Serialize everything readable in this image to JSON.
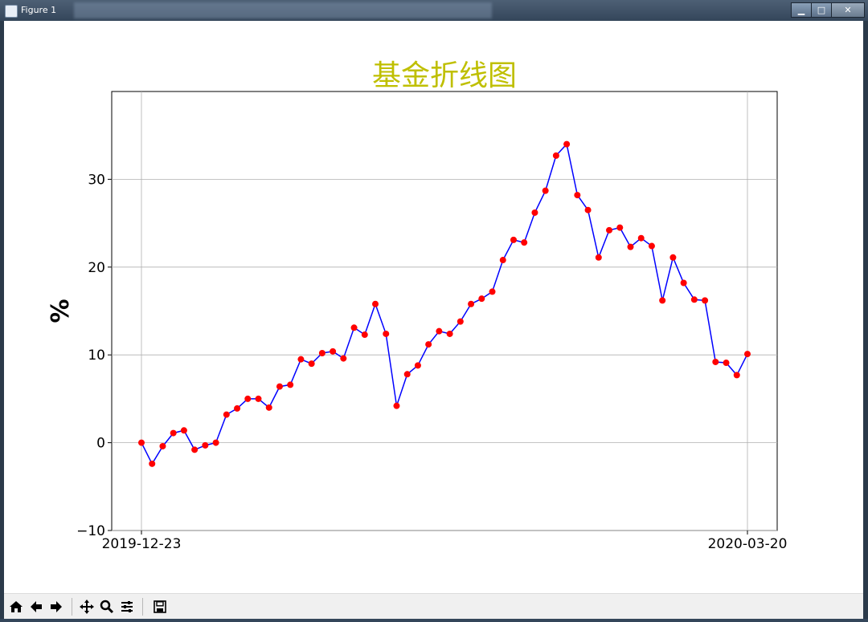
{
  "window": {
    "title": "Figure 1",
    "min_label": "▁",
    "max_label": "□",
    "close_label": "✕"
  },
  "toolbar": {
    "buttons": [
      {
        "name": "home-icon"
      },
      {
        "name": "back-arrow-icon"
      },
      {
        "name": "forward-arrow-icon"
      },
      {
        "name": "pan-icon"
      },
      {
        "name": "zoom-icon"
      },
      {
        "name": "configure-subplots-icon"
      },
      {
        "name": "save-icon"
      }
    ]
  },
  "chart_data": {
    "type": "line",
    "title": "基金折线图",
    "xlabel": "",
    "ylabel": "%",
    "x_tick_labels": [
      "2019-12-23",
      "2020-03-20"
    ],
    "y_ticks": [
      -10,
      0,
      10,
      20,
      30
    ],
    "ylim": [
      -10,
      40
    ],
    "grid": true,
    "colors": {
      "title": "#bfbf00",
      "line": "#0000ff",
      "marker": "#ff0000"
    },
    "values": [
      0.0,
      -2.4,
      -0.4,
      1.1,
      1.4,
      -0.8,
      -0.3,
      0.0,
      3.2,
      3.9,
      5.0,
      5.0,
      4.0,
      6.4,
      6.6,
      9.5,
      9.0,
      10.2,
      10.4,
      9.6,
      13.1,
      12.3,
      15.8,
      12.4,
      4.2,
      7.8,
      8.8,
      11.2,
      12.7,
      12.4,
      13.8,
      15.8,
      16.4,
      17.2,
      20.8,
      23.1,
      22.8,
      26.2,
      28.7,
      32.7,
      34.0,
      28.2,
      26.5,
      21.1,
      24.2,
      24.5,
      22.3,
      23.3,
      22.4,
      16.2,
      21.1,
      18.2,
      16.3,
      16.2,
      9.2,
      9.1,
      7.7,
      10.1
    ]
  }
}
